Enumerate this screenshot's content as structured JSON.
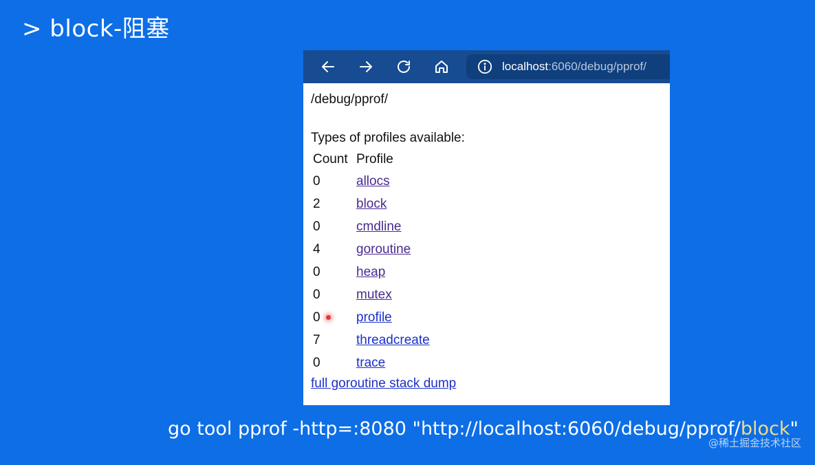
{
  "slide": {
    "title": "> block-阻塞",
    "command_prefix": "go tool pprof -http=:8080 \"http://localhost:6060/debug/pprof/",
    "command_highlight": "block",
    "command_suffix": "\"",
    "footer": "@稀土掘金技术社区"
  },
  "browser": {
    "toolbar": {
      "icons": [
        "back-arrow-icon",
        "forward-arrow-icon",
        "reload-icon",
        "home-icon",
        "info-icon"
      ],
      "url_host": "localhost",
      "url_path": ":6060/debug/pprof/"
    },
    "page": {
      "heading": "/debug/pprof/",
      "types_label": "Types of profiles available:",
      "table_headers": {
        "count": "Count",
        "profile": "Profile"
      },
      "rows": [
        {
          "count": "0",
          "profile": "allocs"
        },
        {
          "count": "2",
          "profile": "block"
        },
        {
          "count": "0",
          "profile": "cmdline"
        },
        {
          "count": "4",
          "profile": "goroutine"
        },
        {
          "count": "0",
          "profile": "heap"
        },
        {
          "count": "0",
          "profile": "mutex"
        },
        {
          "count": "0",
          "profile": "profile"
        },
        {
          "count": "7",
          "profile": "threadcreate"
        },
        {
          "count": "0",
          "profile": "trace"
        }
      ],
      "full_dump_link": "full goroutine stack dump"
    }
  },
  "colors": {
    "background": "#0d6ee6",
    "toolbar": "#174c93",
    "visited_link": "#4a2a8e",
    "link": "#1a2fc9",
    "command_highlight": "#f2dc8a"
  }
}
